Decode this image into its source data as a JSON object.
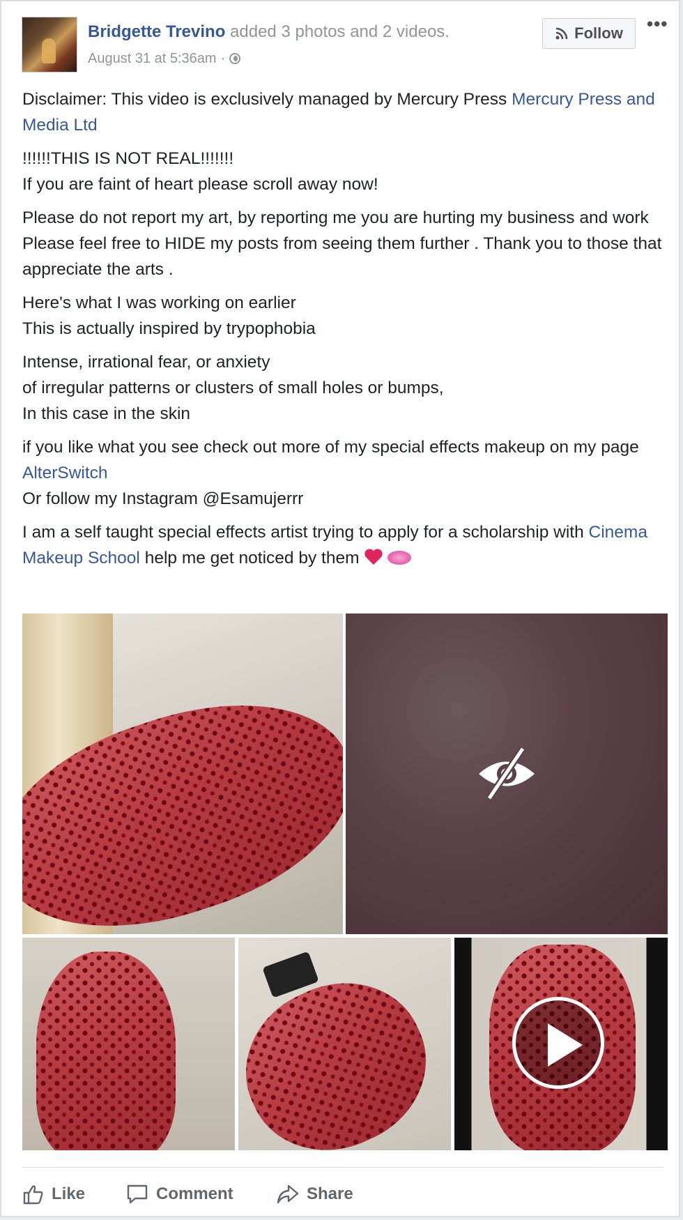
{
  "post": {
    "author": "Bridgette Trevino",
    "action_text": " added 3 photos and 2 videos.",
    "timestamp": "August 31 at 5:36am",
    "separator": "·",
    "privacy_icon": "globe-icon",
    "follow_label": "Follow",
    "more_label": "•••"
  },
  "body": {
    "p1_text": "Disclaimer: This video is exclusively managed by Mercury Press ",
    "p1_link": "Mercury Press and Media Ltd",
    "p2_l1": "!!!!!!THIS IS NOT REAL!!!!!!!",
    "p2_l2": "If you are faint of heart please scroll away now!",
    "p3_l1": "Please do not report my art, by reporting me you are hurting my business and work",
    "p3_l2": "Please feel free to HIDE my posts from seeing them further . Thank you to those that appreciate the arts .",
    "p4_l1": "Here's what I was working on earlier",
    "p4_l2": "This is actually inspired by trypophobia",
    "p5_l1": "Intense, irrational fear, or anxiety",
    "p5_l2": "of irregular patterns or clusters of small holes or bumps,",
    "p5_l3": "In this case in the skin",
    "p6_text": "if you like what you see check out more of my special effects makeup on my page ",
    "p6_link": "AlterSwitch",
    "p6_l2": "Or follow my Instagram @Esamujerrr",
    "p7_text": "I am a self taught special effects artist trying to apply for a scholarship with ",
    "p7_link": "Cinema Makeup School",
    "p7_tail": " help me get noticed by them",
    "emoji": [
      "heart-emoji",
      "kiss-emoji"
    ]
  },
  "media": {
    "items": [
      {
        "kind": "photo",
        "icon": null
      },
      {
        "kind": "video-hidden",
        "icon": "eye-slash-icon"
      },
      {
        "kind": "photo",
        "icon": null
      },
      {
        "kind": "photo",
        "icon": null
      },
      {
        "kind": "video",
        "icon": "play-icon"
      }
    ]
  },
  "actions": {
    "like": "Like",
    "comment": "Comment",
    "share": "Share",
    "icons": [
      "thumbs-up-icon",
      "comment-bubble-icon",
      "share-arrow-icon"
    ]
  },
  "colors": {
    "link": "#365899",
    "text": "#1d2129",
    "muted": "#90949c",
    "action": "#606770"
  }
}
